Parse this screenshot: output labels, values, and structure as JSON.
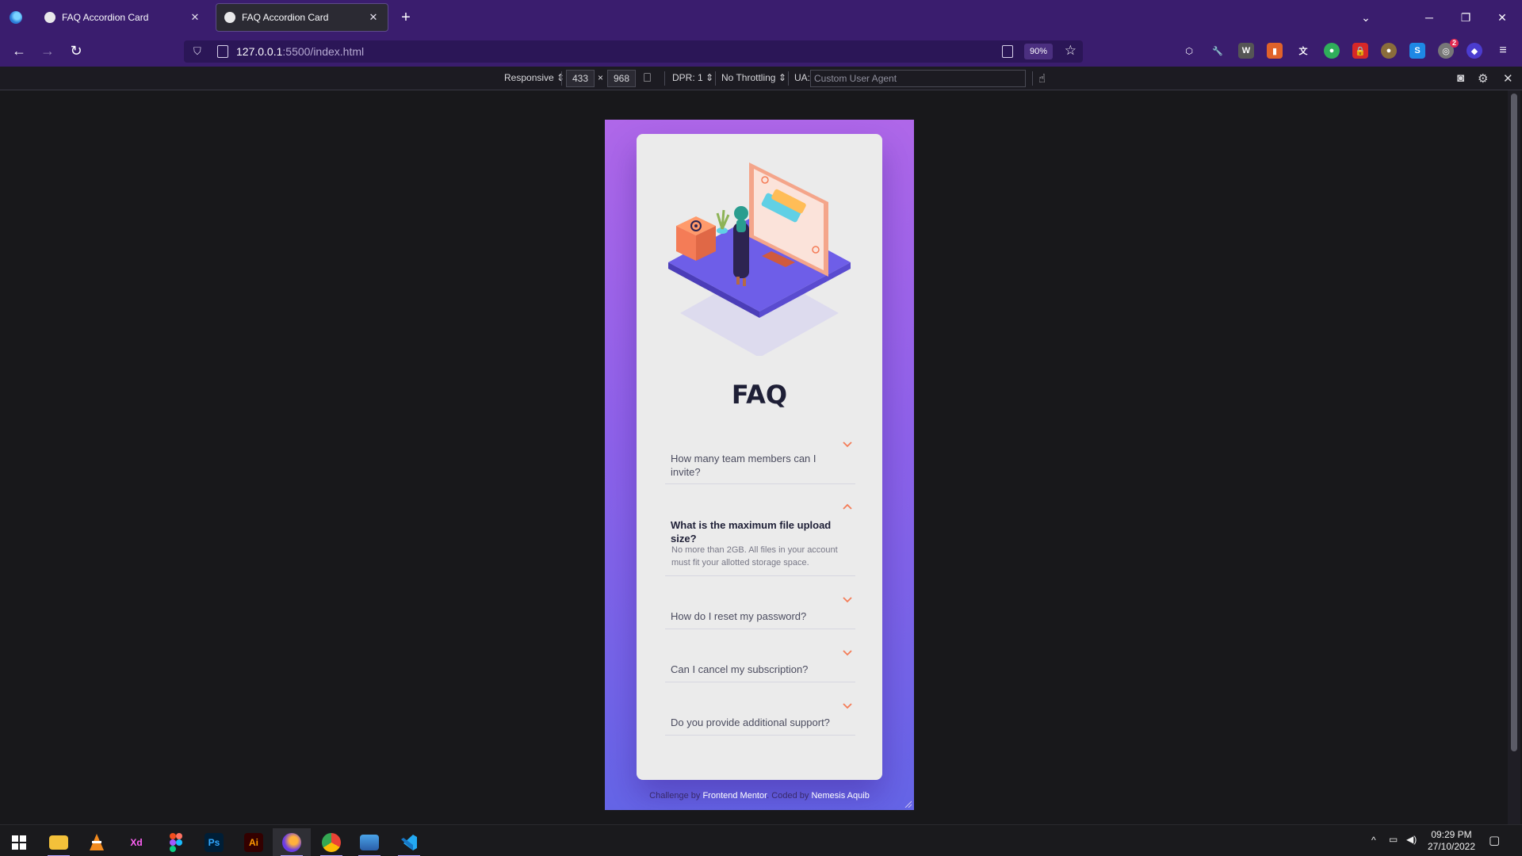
{
  "browser": {
    "tabs": [
      {
        "title": "FAQ Accordion Card",
        "active": false
      },
      {
        "title": "FAQ Accordion Card",
        "active": true
      }
    ],
    "new_tab_label": "+",
    "url_host": "127.0.0.1",
    "url_rest": ":5500/index.html",
    "zoom": "90%",
    "extension_badge": "2"
  },
  "rdm": {
    "device": "Responsive ⇕",
    "width": "433",
    "times": "×",
    "height": "968",
    "dpr": "DPR: 1 ⇕",
    "throttling": "No Throttling ⇕",
    "ua_label": "UA:",
    "ua_placeholder": "Custom User Agent"
  },
  "page": {
    "title": "FAQ",
    "faqs": [
      {
        "question": "How many team members can I invite?",
        "answer": "",
        "open": false
      },
      {
        "question": "What is the maximum file upload size?",
        "answer": "No more than 2GB. All files in your account must fit your allotted storage space.",
        "open": true
      },
      {
        "question": "How do I reset my password?",
        "answer": "",
        "open": false
      },
      {
        "question": "Can I cancel my subscription?",
        "answer": "",
        "open": false
      },
      {
        "question": "Do you provide additional support?",
        "answer": "",
        "open": false
      }
    ],
    "attribution": {
      "prefix": "Challenge by",
      "challenge_link": "Frontend Mentor",
      "middle": ". Coded by",
      "author_link": "Nemesis Aquib"
    },
    "colors": {
      "gradient_top": "#af67e9",
      "gradient_bottom": "#6565e7",
      "card": "#ebebeb",
      "title": "#1e1f36",
      "arrow": "#f47c57"
    }
  },
  "taskbar": {
    "apps": [
      "windows-start",
      "file-explorer",
      "vlc",
      "adobe-xd",
      "figma",
      "photoshop",
      "illustrator",
      "firefox",
      "chrome",
      "photos",
      "vscode"
    ],
    "xd_label": "Xd",
    "ps_label": "Ps",
    "ai_label": "Ai",
    "time": "09:29 PM",
    "date": "27/10/2022"
  }
}
